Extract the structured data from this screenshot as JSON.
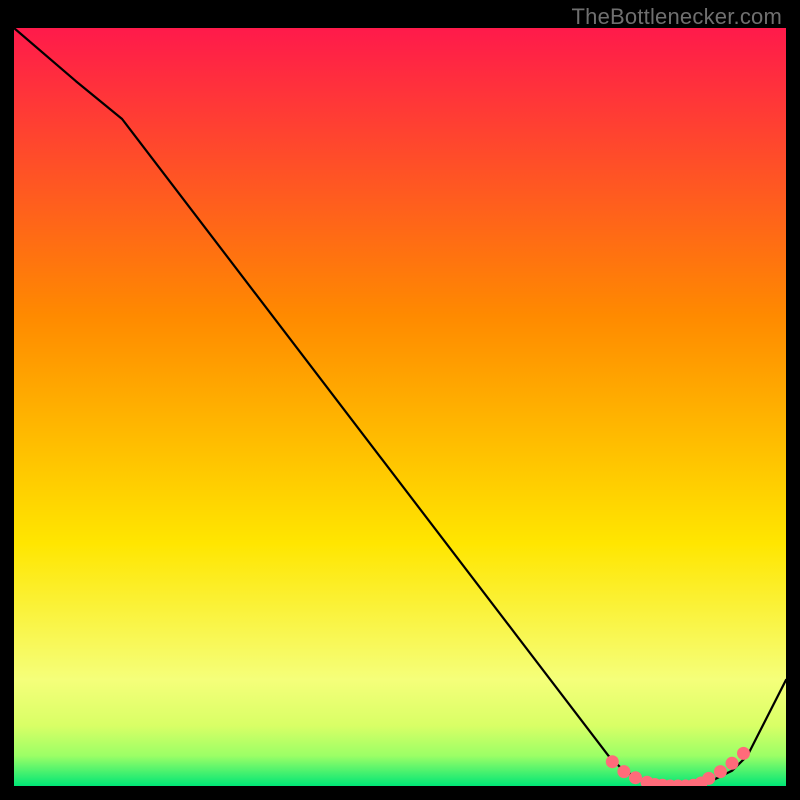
{
  "watermark": "TheBottlenecker.com",
  "chart_data": {
    "type": "line",
    "title": "",
    "xlabel": "",
    "ylabel": "",
    "xlim": [
      0,
      100
    ],
    "ylim": [
      0,
      100
    ],
    "grid": false,
    "series": [
      {
        "name": "bottleneck-curve",
        "x": [
          0,
          8,
          14,
          77,
          79,
          81,
          83,
          85,
          87,
          89,
          91,
          93,
          95,
          100
        ],
        "y": [
          100,
          93,
          88,
          4,
          2,
          1,
          0,
          0,
          0,
          0,
          1,
          2,
          4,
          14
        ]
      }
    ],
    "markers": {
      "name": "highlight-dots",
      "x": [
        77.5,
        79,
        80.5,
        82,
        83,
        84,
        85,
        86,
        87,
        88,
        89,
        90,
        91.5,
        93,
        94.5
      ],
      "y": [
        3.2,
        1.9,
        1.1,
        0.5,
        0.2,
        0.1,
        0.0,
        0.0,
        0.0,
        0.1,
        0.4,
        1.0,
        1.9,
        3.0,
        4.3
      ]
    },
    "background_gradient": {
      "top": "#ff1a4b",
      "mid1": "#ff8a00",
      "mid2": "#ffe600",
      "band1": "#f5ff7a",
      "band2": "#d9ff66",
      "band3": "#9cff66",
      "bottom": "#00e676"
    }
  }
}
